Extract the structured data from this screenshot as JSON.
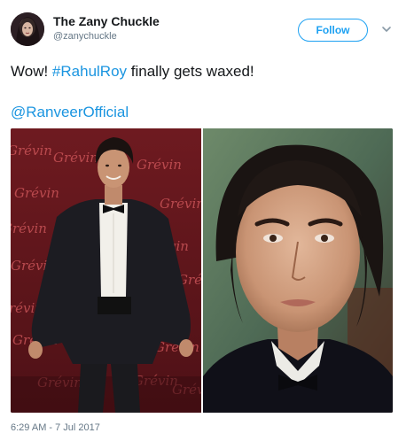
{
  "author": {
    "display_name": "The Zany Chuckle",
    "handle": "@zanychuckle",
    "avatar": "avatar-image"
  },
  "actions": {
    "follow_label": "Follow",
    "more_icon": "chevron-down-icon"
  },
  "tweet": {
    "text_before": "Wow! ",
    "hashtag": "#RahulRoy",
    "text_after": " finally gets waxed!",
    "mention": "@RanveerOfficial"
  },
  "media": {
    "backdrop_text": "Grévin",
    "left_image": "wax-figure-photo",
    "right_image": "actor-portrait-photo"
  },
  "meta": {
    "timestamp": "6:29 AM - 7 Jul 2017"
  },
  "colors": {
    "link": "#1b95e0",
    "follow_accent": "#1da1f2",
    "muted_text": "#657786",
    "backdrop_red": "#7a1f24"
  }
}
